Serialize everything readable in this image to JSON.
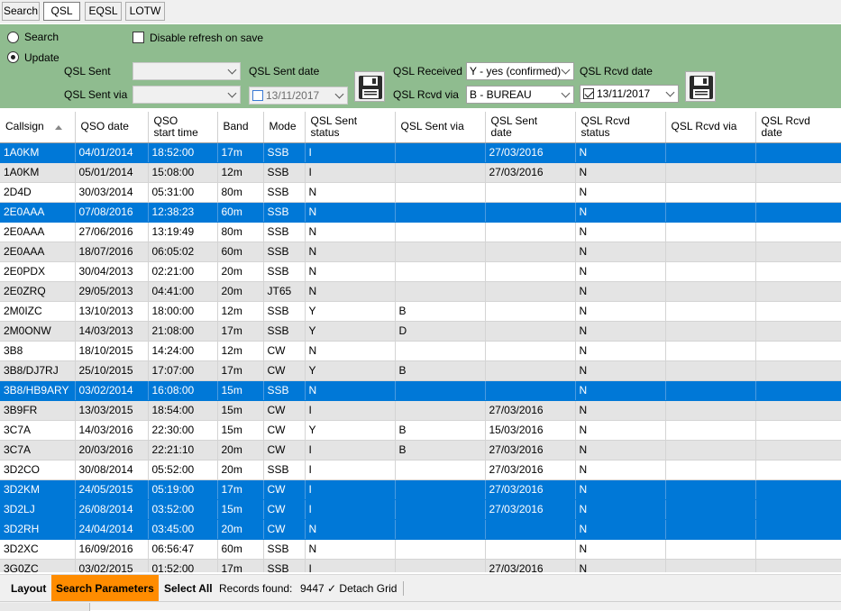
{
  "tabs": [
    {
      "label": "Search",
      "active": false
    },
    {
      "label": "QSL",
      "active": true
    },
    {
      "label": "EQSL",
      "active": false
    },
    {
      "label": "LOTW",
      "active": false
    }
  ],
  "params": {
    "mode_search": "Search",
    "mode_update": "Update",
    "disable_refresh": "Disable refresh on save",
    "qsl_sent_label": "QSL Sent",
    "qsl_sent_value": "",
    "qsl_sent_via_label": "QSL Sent via",
    "qsl_sent_via_value": "",
    "qsl_sent_date_label": "QSL Sent date",
    "qsl_sent_date_value": "13/11/2017",
    "qsl_received_label": "QSL Received",
    "qsl_received_value": "Y - yes (confirmed)",
    "qsl_rcvd_via_label": "QSL Rcvd via",
    "qsl_rcvd_via_value": "B - BUREAU",
    "qsl_rcvd_date_label": "QSL Rcvd date",
    "qsl_rcvd_date_value": "13/11/2017"
  },
  "grid": {
    "columns": [
      {
        "line1": "Callsign",
        "line2": ""
      },
      {
        "line1": "QSO date",
        "line2": ""
      },
      {
        "line1": "QSO",
        "line2": "start time"
      },
      {
        "line1": "Band",
        "line2": ""
      },
      {
        "line1": "Mode",
        "line2": ""
      },
      {
        "line1": "QSL Sent",
        "line2": "status"
      },
      {
        "line1": "QSL Sent via",
        "line2": ""
      },
      {
        "line1": "QSL Sent",
        "line2": "date"
      },
      {
        "line1": "QSL Rcvd",
        "line2": "status"
      },
      {
        "line1": "QSL Rcvd via",
        "line2": ""
      },
      {
        "line1": "QSL Rcvd",
        "line2": "date"
      }
    ],
    "rows": [
      {
        "selected": true,
        "cells": [
          "1A0KM",
          "04/01/2014",
          "18:52:00",
          "17m",
          "SSB",
          "I",
          "",
          "27/03/2016",
          "N",
          "",
          ""
        ]
      },
      {
        "selected": false,
        "cells": [
          "1A0KM",
          "05/01/2014",
          "15:08:00",
          "12m",
          "SSB",
          "I",
          "",
          "27/03/2016",
          "N",
          "",
          ""
        ]
      },
      {
        "selected": false,
        "cells": [
          "2D4D",
          "30/03/2014",
          "05:31:00",
          "80m",
          "SSB",
          "N",
          "",
          "",
          "N",
          "",
          ""
        ]
      },
      {
        "selected": true,
        "cells": [
          "2E0AAA",
          "07/08/2016",
          "12:38:23",
          "60m",
          "SSB",
          "N",
          "",
          "",
          "N",
          "",
          ""
        ]
      },
      {
        "selected": false,
        "cells": [
          "2E0AAA",
          "27/06/2016",
          "13:19:49",
          "80m",
          "SSB",
          "N",
          "",
          "",
          "N",
          "",
          ""
        ]
      },
      {
        "selected": false,
        "cells": [
          "2E0AAA",
          "18/07/2016",
          "06:05:02",
          "60m",
          "SSB",
          "N",
          "",
          "",
          "N",
          "",
          ""
        ]
      },
      {
        "selected": false,
        "cells": [
          "2E0PDX",
          "30/04/2013",
          "02:21:00",
          "20m",
          "SSB",
          "N",
          "",
          "",
          "N",
          "",
          ""
        ]
      },
      {
        "selected": false,
        "cells": [
          "2E0ZRQ",
          "29/05/2013",
          "04:41:00",
          "20m",
          "JT65",
          "N",
          "",
          "",
          "N",
          "",
          ""
        ]
      },
      {
        "selected": false,
        "cells": [
          "2M0IZC",
          "13/10/2013",
          "18:00:00",
          "12m",
          "SSB",
          "Y",
          "B",
          "",
          "N",
          "",
          ""
        ]
      },
      {
        "selected": false,
        "cells": [
          "2M0ONW",
          "14/03/2013",
          "21:08:00",
          "17m",
          "SSB",
          "Y",
          "D",
          "",
          "N",
          "",
          ""
        ]
      },
      {
        "selected": false,
        "cells": [
          "3B8",
          "18/10/2015",
          "14:24:00",
          "12m",
          "CW",
          "N",
          "",
          "",
          "N",
          "",
          ""
        ]
      },
      {
        "selected": false,
        "cells": [
          "3B8/DJ7RJ",
          "25/10/2015",
          "17:07:00",
          "17m",
          "CW",
          "Y",
          "B",
          "",
          "N",
          "",
          ""
        ]
      },
      {
        "selected": true,
        "cells": [
          "3B8/HB9ARY",
          "03/02/2014",
          "16:08:00",
          "15m",
          "SSB",
          "N",
          "",
          "",
          "N",
          "",
          ""
        ]
      },
      {
        "selected": false,
        "cells": [
          "3B9FR",
          "13/03/2015",
          "18:54:00",
          "15m",
          "CW",
          "I",
          "",
          "27/03/2016",
          "N",
          "",
          ""
        ]
      },
      {
        "selected": false,
        "cells": [
          "3C7A",
          "14/03/2016",
          "22:30:00",
          "15m",
          "CW",
          "Y",
          "B",
          "15/03/2016",
          "N",
          "",
          ""
        ]
      },
      {
        "selected": false,
        "cells": [
          "3C7A",
          "20/03/2016",
          "22:21:10",
          "20m",
          "CW",
          "I",
          "B",
          "27/03/2016",
          "N",
          "",
          ""
        ]
      },
      {
        "selected": false,
        "cells": [
          "3D2CO",
          "30/08/2014",
          "05:52:00",
          "20m",
          "SSB",
          "I",
          "",
          "27/03/2016",
          "N",
          "",
          ""
        ]
      },
      {
        "selected": true,
        "cells": [
          "3D2KM",
          "24/05/2015",
          "05:19:00",
          "17m",
          "CW",
          "I",
          "",
          "27/03/2016",
          "N",
          "",
          ""
        ]
      },
      {
        "selected": true,
        "cells": [
          "3D2LJ",
          "26/08/2014",
          "03:52:00",
          "15m",
          "CW",
          "I",
          "",
          "27/03/2016",
          "N",
          "",
          ""
        ]
      },
      {
        "selected": true,
        "cells": [
          "3D2RH",
          "24/04/2014",
          "03:45:00",
          "20m",
          "CW",
          "N",
          "",
          "",
          "N",
          "",
          ""
        ]
      },
      {
        "selected": false,
        "cells": [
          "3D2XC",
          "16/09/2016",
          "06:56:47",
          "60m",
          "SSB",
          "N",
          "",
          "",
          "N",
          "",
          ""
        ]
      },
      {
        "selected": false,
        "cells": [
          "3G0ZC",
          "03/02/2015",
          "01:52:00",
          "17m",
          "SSB",
          "I",
          "",
          "27/03/2016",
          "N",
          "",
          ""
        ]
      }
    ]
  },
  "statusbar": {
    "layout": "Layout",
    "search_parameters": "Search Parameters",
    "select_all": "Select All",
    "records_label": "Records found:",
    "records_count": "9447",
    "detach_grid": "Detach Grid"
  },
  "colors": {
    "panel_green": "#8fbc8f",
    "selection_blue": "#0078d7",
    "search_params_orange": "#ff8c00"
  }
}
